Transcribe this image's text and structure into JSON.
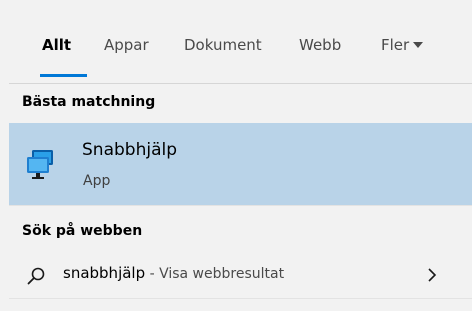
{
  "tabs": {
    "items": [
      {
        "label": "Allt",
        "active": true
      },
      {
        "label": "Appar",
        "active": false
      },
      {
        "label": "Dokument",
        "active": false
      },
      {
        "label": "Webb",
        "active": false
      },
      {
        "label": "Fler",
        "active": false
      }
    ],
    "accent_color": "#0078d7"
  },
  "best_match": {
    "header": "Bästa matchning",
    "app_name": "Snabbhjälp",
    "app_type": "App",
    "icon": "quick-assist-monitor-icon",
    "highlight_color": "#b9d3e8"
  },
  "web": {
    "header": "Sök på webben",
    "query": "snabbhjälp",
    "suffix": " - Visa webbresultat",
    "icon": "search-icon",
    "chevron_icon": "chevron-right-icon"
  }
}
